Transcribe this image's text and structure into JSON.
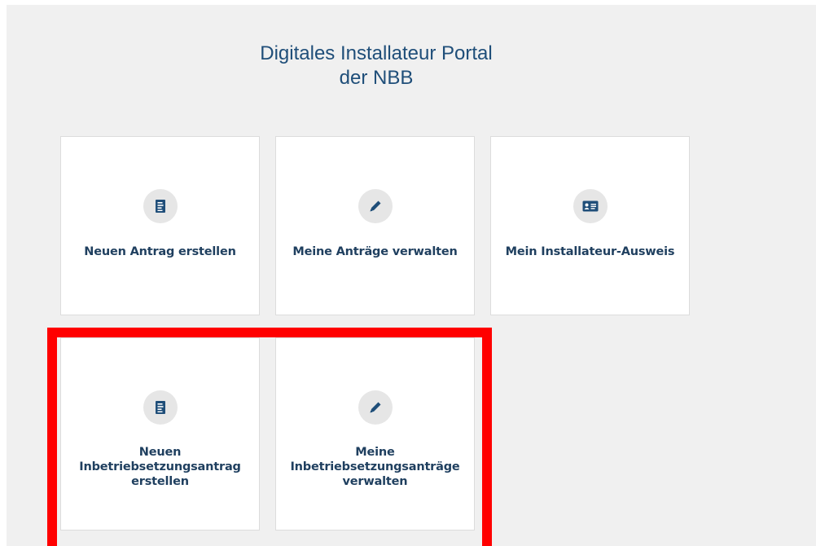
{
  "header": {
    "title_line1": "Digitales Installateur Portal",
    "title_line2": "der NBB"
  },
  "tiles": [
    {
      "label": "Neuen Antrag erstellen",
      "icon": "document-icon"
    },
    {
      "label": "Meine Anträge verwalten",
      "icon": "pencil-icon"
    },
    {
      "label": "Mein Installateur-Ausweis",
      "icon": "id-card-icon"
    },
    {
      "label_line1": "Neuen Inbetriebsetzungsantrag",
      "label_line2": "erstellen",
      "icon": "document-icon"
    },
    {
      "label_line1": "Meine Inbetriebsetzungsanträge",
      "label_line2": "verwalten",
      "icon": "pencil-icon"
    }
  ],
  "colors": {
    "background": "#f0f0f0",
    "tile": "#ffffff",
    "title": "#1f4e79",
    "icon": "#1f4e79",
    "icon_circle": "#e6e6e6",
    "highlight": "#ff0000"
  }
}
